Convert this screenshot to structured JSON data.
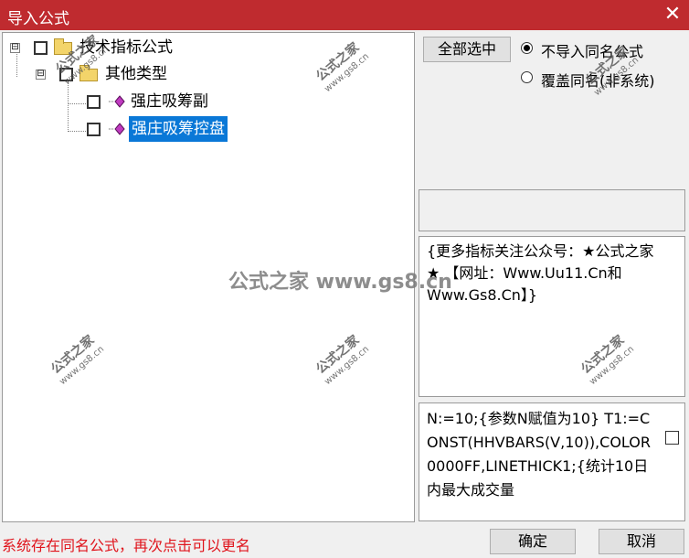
{
  "window": {
    "title": "导入公式",
    "close_glyph": "✕",
    "title_color": "#bf2b2f"
  },
  "tree": {
    "root": {
      "label": "技术指标公式",
      "expander": "⊟"
    },
    "group": {
      "label": "其他类型",
      "expander": "⊟"
    },
    "items": [
      {
        "label": "强庄吸筹副",
        "selected": false
      },
      {
        "label": "强庄吸筹控盘",
        "selected": true
      }
    ],
    "selection_color": "#0a78d7"
  },
  "options": {
    "select_all_label": "全部选中",
    "radio_skip_label": "不导入同名公式",
    "radio_overwrite_label": "覆盖同名(非系统)",
    "selected": "skip"
  },
  "description": "{更多指标关注公众号：★公式之家★ 【网址：Www.Uu11.Cn和Www.Gs8.Cn】}",
  "code": "N:=10;{参数N赋值为10} T1:=CONST(HHVBARS(V,10)),COLOR0000FF,LINETHICK1;{统计10日内最大成交量",
  "status_message": "系统存在同名公式，再次点击可以更名",
  "status_color": "#e0141c",
  "buttons": {
    "ok": "确定",
    "cancel": "取消"
  },
  "watermark": {
    "main": "公式之家 www.gs8.cn",
    "stamp": "公式之家",
    "stamp_url": "www.gs8.cn"
  }
}
